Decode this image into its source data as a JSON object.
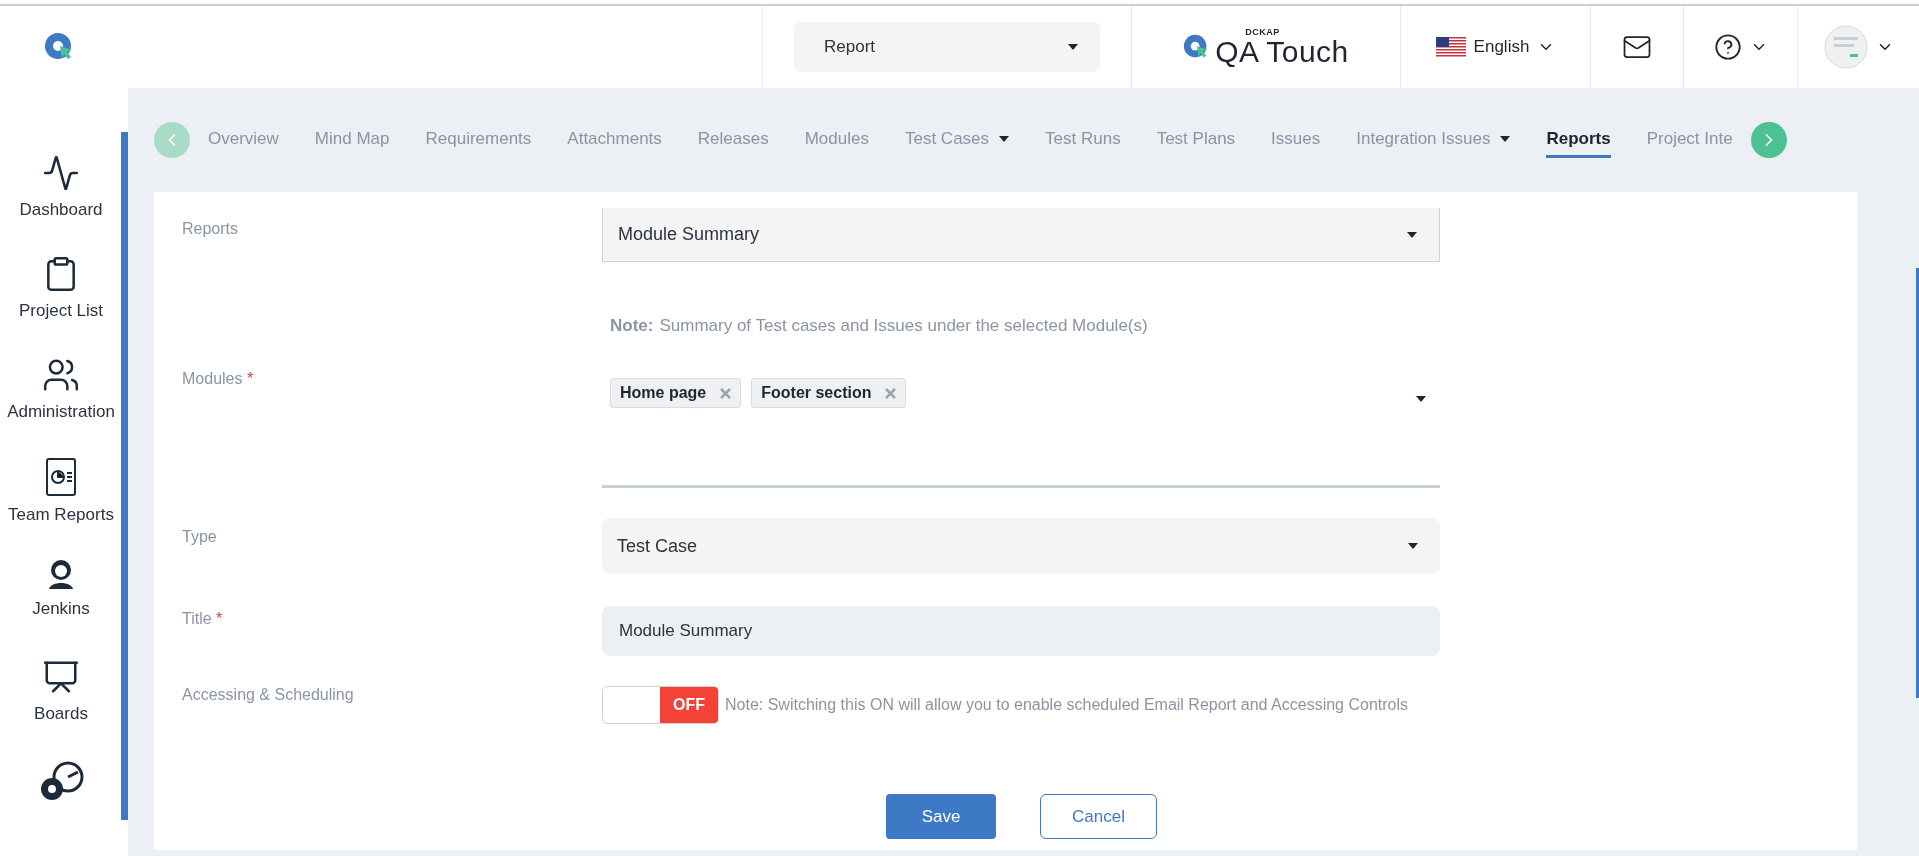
{
  "header": {
    "report_select": "Report",
    "brand": {
      "small": "DCKAP",
      "name": "QA Touch"
    },
    "language": "English"
  },
  "sidebar": {
    "items": [
      {
        "label": "Dashboard"
      },
      {
        "label": "Project List"
      },
      {
        "label": "Administration"
      },
      {
        "label": "Team Reports"
      },
      {
        "label": "Jenkins"
      },
      {
        "label": "Boards"
      }
    ]
  },
  "tabs": [
    {
      "label": "Overview",
      "selected": false,
      "dropdown": false
    },
    {
      "label": "Mind Map",
      "selected": false,
      "dropdown": false
    },
    {
      "label": "Requirements",
      "selected": false,
      "dropdown": false
    },
    {
      "label": "Attachments",
      "selected": false,
      "dropdown": false
    },
    {
      "label": "Releases",
      "selected": false,
      "dropdown": false
    },
    {
      "label": "Modules",
      "selected": false,
      "dropdown": false
    },
    {
      "label": "Test Cases",
      "selected": false,
      "dropdown": true
    },
    {
      "label": "Test Runs",
      "selected": false,
      "dropdown": false
    },
    {
      "label": "Test Plans",
      "selected": false,
      "dropdown": false
    },
    {
      "label": "Issues",
      "selected": false,
      "dropdown": false
    },
    {
      "label": "Integration Issues",
      "selected": false,
      "dropdown": true
    },
    {
      "label": "Reports",
      "selected": true,
      "dropdown": false
    },
    {
      "label": "Project Inte",
      "selected": false,
      "dropdown": false
    }
  ],
  "form": {
    "reports": {
      "label": "Reports",
      "value": "Module Summary",
      "note_bold": "Note:",
      "note": "Summary of Test cases and Issues under the selected Module(s)"
    },
    "modules": {
      "label": "Modules",
      "required_mark": "*",
      "chips": [
        "Home page",
        "Footer section"
      ]
    },
    "type": {
      "label": "Type",
      "value": "Test Case"
    },
    "title": {
      "label": "Title",
      "required_mark": "*",
      "value": "Module Summary"
    },
    "access": {
      "label": "Accessing & Scheduling",
      "on": false,
      "toggle_text": "OFF",
      "note": "Note: Switching this ON will allow you to enable scheduled Email Report and Accessing Controls"
    },
    "buttons": {
      "save": "Save",
      "cancel": "Cancel"
    }
  }
}
